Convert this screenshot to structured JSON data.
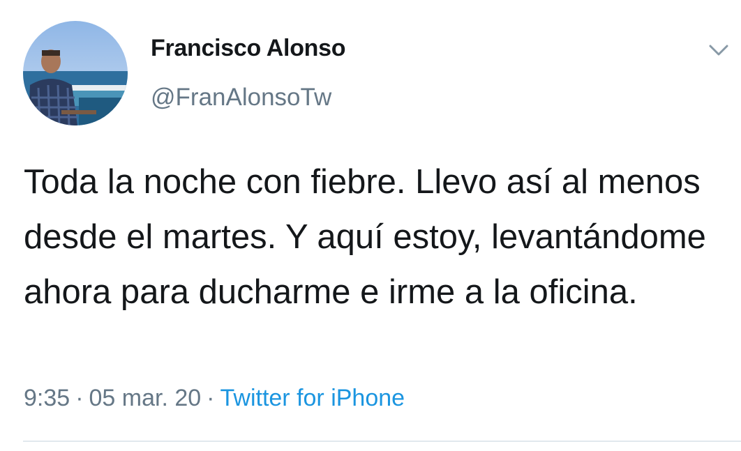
{
  "author": {
    "name": "Francisco Alonso",
    "handle": "@FranAlonsoTw",
    "avatar_icon": "profile-photo"
  },
  "tweet": {
    "text": "Toda la noche con fiebre. Llevo así al menos desde el martes. Y aquí estoy, levantándome ahora para ducharme e irme a la oficina."
  },
  "meta": {
    "time": "9:35",
    "separator": "·",
    "date": "05 mar. 20",
    "source": "Twitter for iPhone"
  },
  "menu": {
    "icon": "chevron-down-icon"
  },
  "colors": {
    "text": "#14171a",
    "secondary": "#657786",
    "link": "#1b95e0",
    "divider": "#e1e8ed"
  }
}
